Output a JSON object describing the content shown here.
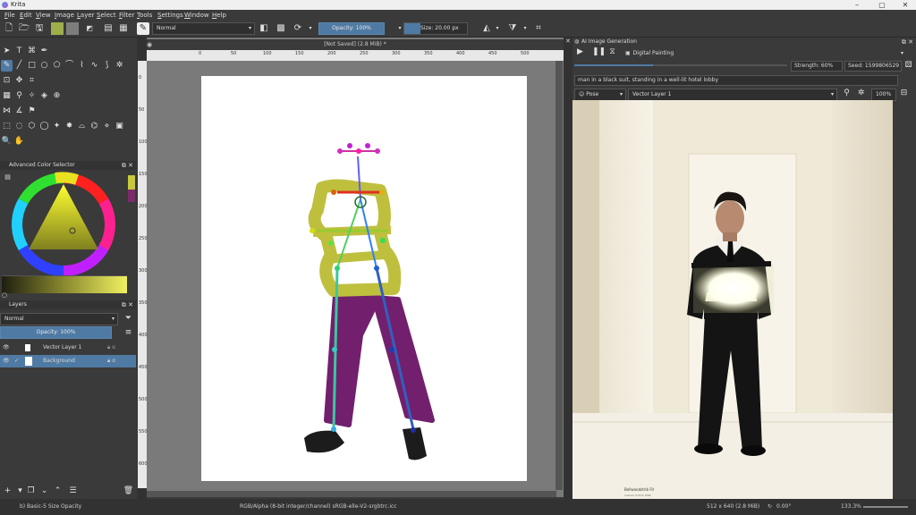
{
  "window": {
    "title": "Krita",
    "min_icon": "minimize-icon",
    "max_icon": "maximize-icon",
    "close_icon": "close-icon"
  },
  "menu": [
    "File",
    "Edit",
    "View",
    "Image",
    "Layer",
    "Select",
    "Filter",
    "Tools",
    "Settings",
    "Window",
    "Help"
  ],
  "toolbar": {
    "blend_mode": "Normal",
    "opacity": "Opacity: 100%",
    "size": "Size: 20.00 px",
    "fg_color": "#9fae4a",
    "bg_color": "#7d7d7d"
  },
  "document": {
    "tab_title": "[Not Saved]  (2.8 MiB) *"
  },
  "rulers": {
    "h": [
      "0",
      "50",
      "100",
      "150",
      "200",
      "250",
      "300",
      "350",
      "400",
      "450",
      "500"
    ],
    "v": [
      "0",
      "50",
      "100",
      "150",
      "200",
      "250",
      "300",
      "350",
      "400",
      "450",
      "500",
      "550",
      "600"
    ]
  },
  "color_selector": {
    "title": "Advanced Color Selector",
    "fg": "#c8c83a",
    "bg": "#7a2c6a"
  },
  "layers": {
    "title": "Layers",
    "blend_mode": "Normal",
    "opacity": "Opacity: 100%",
    "items": [
      {
        "name": "Vector Layer 1",
        "selected": false
      },
      {
        "name": "Background",
        "selected": true
      }
    ]
  },
  "ai": {
    "title": "AI Image Generation",
    "style": "Digital Painting",
    "prompt": "man in a black suit, standing in a well-lit hotel lobby",
    "strength": "Strength: 60%",
    "seed": "Seed: 1599806529",
    "control_type": "Pose",
    "control_layer": "Vector Layer 1",
    "zoom": "100%",
    "watermark_line1": "Bellwoodstrib Fit",
    "watermark_line2": "Liebest Untrah DNB",
    "progress": 0.37
  },
  "statusbar": {
    "brush": "b) Basic-5 Size Opacity",
    "color_space": "RGB/Alpha (8-bit integer/channel)  sRGB-elle-V2-srgbtrc.icc",
    "dims": "512 x 640 (2.8 MiB)",
    "angle": "0.00°",
    "zoom": "133.3%"
  }
}
